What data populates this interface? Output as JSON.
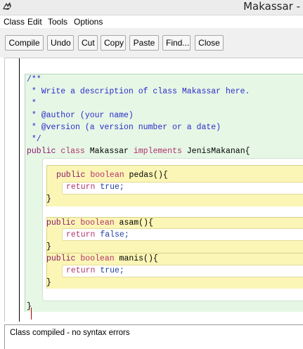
{
  "window": {
    "title": "Makassar - "
  },
  "menu": {
    "items": [
      "Class",
      "Edit",
      "Tools",
      "Options"
    ]
  },
  "toolbar": {
    "buttons": [
      "Compile",
      "Undo",
      "Cut",
      "Copy",
      "Paste",
      "Find...",
      "Close"
    ]
  },
  "editor": {
    "lines": {
      "c1": "/**",
      "c2": " * Write a description of class Makassar here.",
      "c3": " *",
      "c4": " * @author (your name)",
      "c5": " * @version (a version number or a date)",
      "c6": " */",
      "decl_public": "public",
      "decl_class": " class",
      "decl_name": " Makassar ",
      "decl_implements": "implements",
      "decl_iface": " JenisMakanan{",
      "m1_public": "public",
      "m1_boolean": " boolean",
      "m1_sig": " pedas(){",
      "m1_return": "return",
      "m1_value": " true;",
      "m1_close": "}",
      "m2_public": "public",
      "m2_boolean": " boolean",
      "m2_sig": " asam(){",
      "m2_return": "return",
      "m2_value": " false;",
      "m2_close": "}",
      "m3_public": "public",
      "m3_boolean": " boolean",
      "m3_sig": " manis(){",
      "m3_return": "return",
      "m3_value": " true;",
      "m3_close": "}",
      "class_close": "}"
    }
  },
  "status": {
    "text": "Class compiled - no syntax errors"
  },
  "colors": {
    "class_scope": "#e6f7e6",
    "method_scope": "#fcf6b6",
    "comment": "#2c2cc8",
    "keyword": "#b0336b"
  }
}
